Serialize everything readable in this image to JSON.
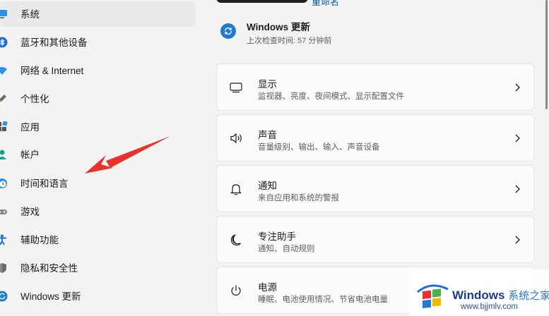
{
  "sidebar": {
    "items": [
      {
        "label": "系统",
        "icon": "monitor-icon",
        "selected": true
      },
      {
        "label": "蓝牙和其他设备",
        "icon": "bluetooth-icon"
      },
      {
        "label": "网络 & Internet",
        "icon": "wifi-icon"
      },
      {
        "label": "个性化",
        "icon": "brush-icon"
      },
      {
        "label": "应用",
        "icon": "apps-icon"
      },
      {
        "label": "帐户",
        "icon": "account-icon"
      },
      {
        "label": "时间和语言",
        "icon": "clock-globe-icon"
      },
      {
        "label": "游戏",
        "icon": "gamepad-icon"
      },
      {
        "label": "辅助功能",
        "icon": "accessibility-icon"
      },
      {
        "label": "隐私和安全性",
        "icon": "shield-icon"
      },
      {
        "label": "Windows 更新",
        "icon": "windows-update-icon"
      }
    ]
  },
  "header": {
    "rename_link": "重命名",
    "update": {
      "title": "Windows 更新",
      "subtitle": "上次检查时间: 57 分钟前",
      "icon": "sync-icon"
    }
  },
  "cards": [
    {
      "title": "显示",
      "subtitle": "监视器、亮度、夜间模式、显示配置文件",
      "icon": "display-icon"
    },
    {
      "title": "声音",
      "subtitle": "音量级别、输出、输入、声音设备",
      "icon": "speaker-icon"
    },
    {
      "title": "通知",
      "subtitle": "来自应用和系统的警报",
      "icon": "bell-icon"
    },
    {
      "title": "专注助手",
      "subtitle": "通知、自动规则",
      "icon": "moon-icon"
    },
    {
      "title": "电源",
      "subtitle": "睡眠、电池使用情况、节省电池电量",
      "icon": "power-icon"
    }
  ],
  "watermark": {
    "brand": "Windows",
    "brand_cn": "系统之家",
    "url": "www.bjjmlv.com"
  },
  "colors": {
    "accent": "#1f7ad1",
    "arrow": "#e8322b",
    "background": "#f3f3f3",
    "card": "#fbfbfb"
  }
}
